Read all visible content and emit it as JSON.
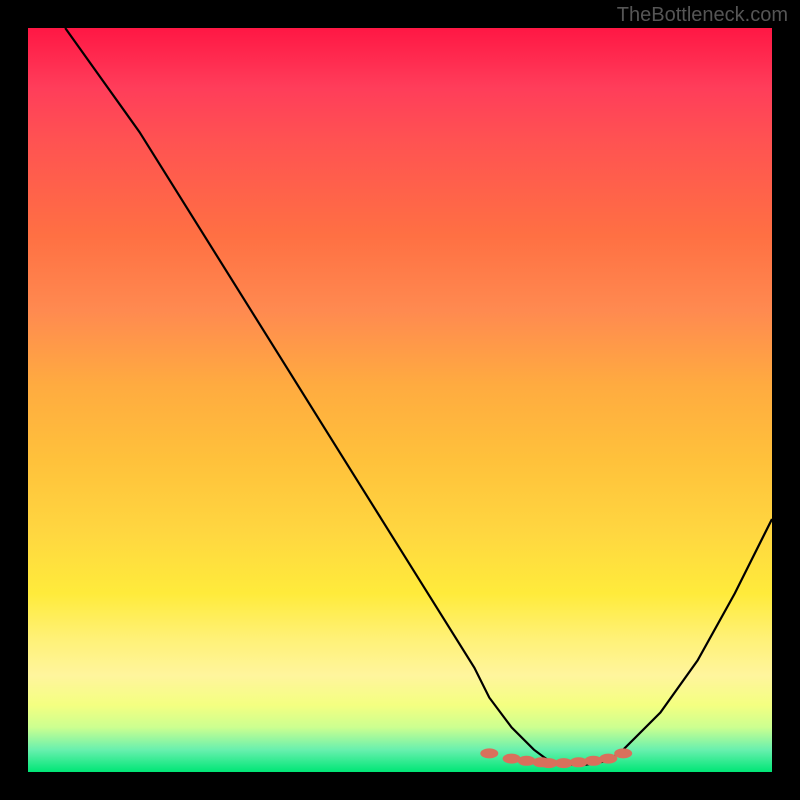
{
  "watermark": "TheBottleneck.com",
  "chart_data": {
    "type": "line",
    "title": "",
    "xlabel": "",
    "ylabel": "",
    "xlim": [
      0,
      100
    ],
    "ylim": [
      0,
      100
    ],
    "series": [
      {
        "name": "bottleneck-curve",
        "x": [
          5,
          10,
          15,
          20,
          25,
          30,
          35,
          40,
          45,
          50,
          55,
          60,
          62,
          65,
          68,
          70,
          72,
          75,
          78,
          80,
          85,
          90,
          95,
          100
        ],
        "y": [
          100,
          93,
          86,
          78,
          70,
          62,
          54,
          46,
          38,
          30,
          22,
          14,
          10,
          6,
          3,
          1.5,
          1,
          1,
          1.5,
          3,
          8,
          15,
          24,
          34
        ]
      }
    ],
    "markers": {
      "name": "optimal-range-markers",
      "x": [
        62,
        65,
        67,
        69,
        70,
        72,
        74,
        76,
        78,
        80
      ],
      "y": [
        2.5,
        1.8,
        1.5,
        1.3,
        1.2,
        1.2,
        1.3,
        1.5,
        1.8,
        2.5
      ],
      "color": "#d9705c"
    },
    "gradient_colors": {
      "top": "#ff1744",
      "mid_high": "#ff7043",
      "mid": "#ffd740",
      "mid_low": "#fff176",
      "bottom": "#00e676"
    }
  }
}
